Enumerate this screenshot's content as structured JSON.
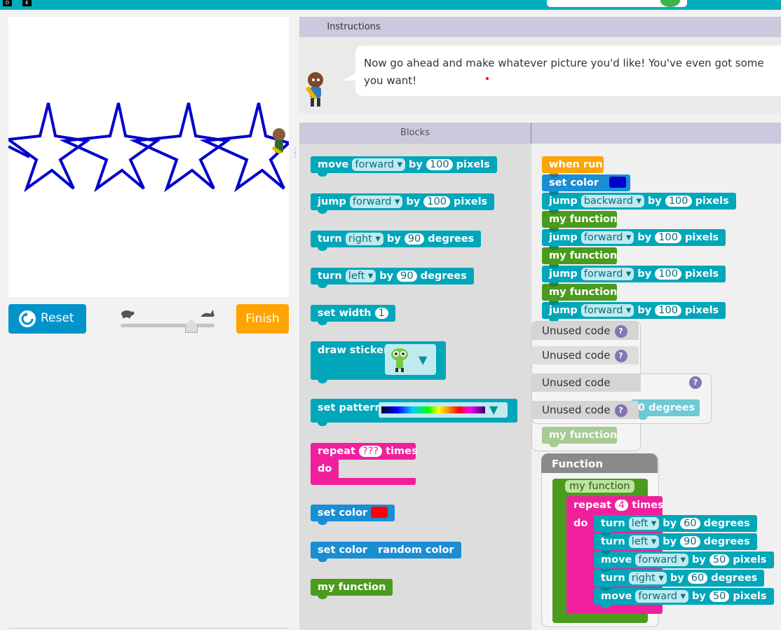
{
  "topbar": {
    "key1": "D",
    "key2": "E"
  },
  "controls": {
    "reset_label": "Reset",
    "finish_label": "Finish"
  },
  "instructions": {
    "tab_label": "Instructions",
    "text": "Now go ahead and make whatever picture you'd like! You've even got some\nyou want!"
  },
  "blocks_panel": {
    "header_label": "Blocks"
  },
  "toolbox": {
    "move": {
      "label": "move",
      "dir": "forward",
      "by": "by",
      "value": "100",
      "unit": "pixels"
    },
    "jump": {
      "label": "jump",
      "dir": "forward",
      "by": "by",
      "value": "100",
      "unit": "pixels"
    },
    "turn_right": {
      "label": "turn",
      "dir": "right",
      "by": "by",
      "value": "90",
      "unit": "degrees"
    },
    "turn_left": {
      "label": "turn",
      "dir": "left",
      "by": "by",
      "value": "90",
      "unit": "degrees"
    },
    "set_width": {
      "label": "set width",
      "value": "1"
    },
    "draw_sticker": {
      "label": "draw sticker"
    },
    "set_pattern": {
      "label": "set pattern"
    },
    "repeat": {
      "label": "repeat",
      "value": "???",
      "times": "times",
      "do": "do"
    },
    "set_color_red": {
      "label": "set color",
      "color": "#ff0000"
    },
    "set_color_random": {
      "label": "set color",
      "value": "random color"
    },
    "my_function": {
      "label": "my function"
    }
  },
  "workspace": {
    "when_run": "when run",
    "set_color": {
      "label": "set color",
      "color": "#0000cc"
    },
    "jump1": {
      "label": "jump",
      "dir": "backward",
      "by": "by",
      "value": "100",
      "unit": "pixels"
    },
    "my_function_label": "my function",
    "jump2": {
      "label": "jump",
      "dir": "forward",
      "by": "by",
      "value": "100",
      "unit": "pixels"
    },
    "jump3": {
      "label": "jump",
      "dir": "forward",
      "by": "by",
      "value": "100",
      "unit": "pixels"
    },
    "jump4": {
      "label": "jump",
      "dir": "forward",
      "by": "by",
      "value": "100",
      "unit": "pixels"
    },
    "unused_label": "Unused code",
    "unused_q": "?",
    "unused_degrees": "degrees",
    "unused_degrees_value": "0",
    "unused_fn": "my function",
    "function_header": "Function",
    "fn_def": "my function",
    "fn_repeat": {
      "label": "repeat",
      "value": "4",
      "times": "times",
      "do": "do"
    },
    "fn_turn_left_60": {
      "label": "turn",
      "dir": "left",
      "by": "by",
      "value": "60",
      "unit": "degrees"
    },
    "fn_turn_left_90": {
      "label": "turn",
      "dir": "left",
      "by": "by",
      "value": "90",
      "unit": "degrees"
    },
    "fn_move_50a": {
      "label": "move",
      "dir": "forward",
      "by": "by",
      "value": "50",
      "unit": "pixels"
    },
    "fn_turn_right_60": {
      "label": "turn",
      "dir": "right",
      "by": "by",
      "value": "60",
      "unit": "degrees"
    },
    "fn_move_50b": {
      "label": "move",
      "dir": "forward",
      "by": "by",
      "value": "50",
      "unit": "pixels"
    }
  },
  "colors": {
    "accent": "#00adbc",
    "reset_button": "#0094ca",
    "finish_button": "#ffa400",
    "drawing_stroke": "#0000cc"
  }
}
